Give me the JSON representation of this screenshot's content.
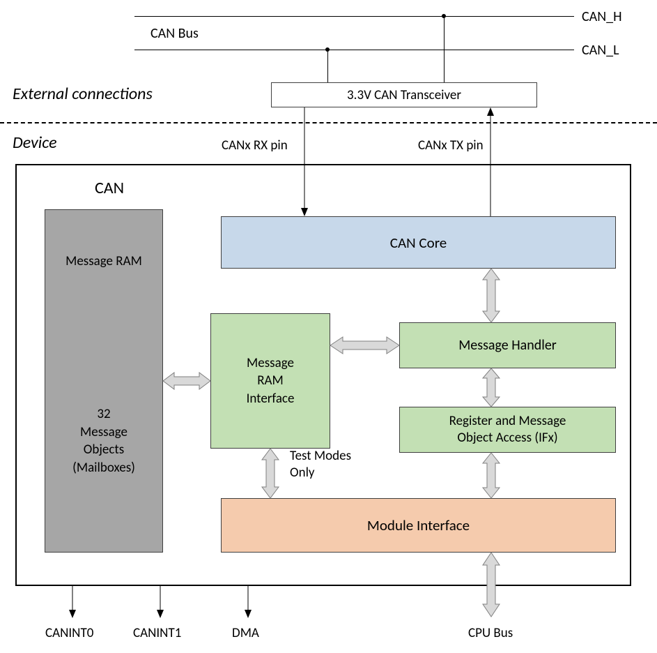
{
  "labels": {
    "can_bus": "CAN Bus",
    "can_h": "CAN_H",
    "can_l": "CAN_L",
    "transceiver": "3.3V CAN Transceiver",
    "external": "External connections",
    "device": "Device",
    "rx_pin": "CANx RX pin",
    "tx_pin": "CANx TX pin",
    "can": "CAN",
    "msg_ram_title": "Message RAM",
    "msg_ram_body": "32\nMessage\nObjects\n(Mailboxes)",
    "can_core": "CAN Core",
    "msg_ram_if": "Message\nRAM\nInterface",
    "msg_handler": "Message Handler",
    "reg_access": "Register and Message\nObject Access (IFx)",
    "test_modes": "Test Modes\nOnly",
    "module_if": "Module Interface",
    "canint0": "CANINT0",
    "canint1": "CANINT1",
    "dma": "DMA",
    "cpu_bus": "CPU Bus"
  },
  "colors": {
    "gray": "#a6a6a6",
    "blue": "#c7d8ea",
    "green": "#c3e0b4",
    "orange": "#f5cbad",
    "arrow_fill": "#d9d9d9",
    "arrow_stroke": "#7f7f7f"
  }
}
